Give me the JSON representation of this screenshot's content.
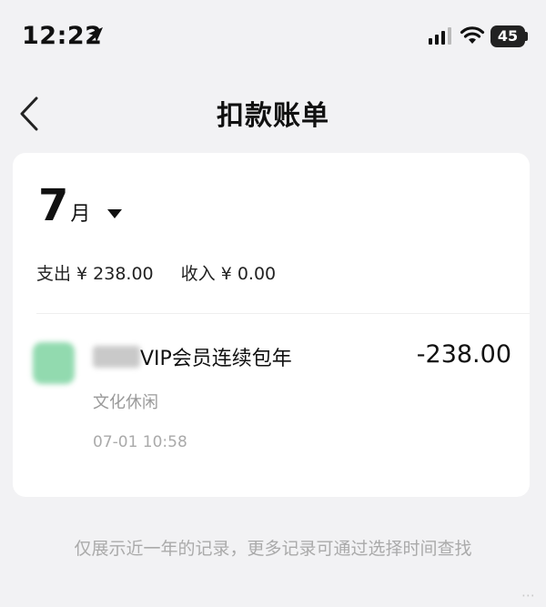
{
  "status_bar": {
    "time": "12:22",
    "battery": "45"
  },
  "nav": {
    "title": "扣款账单"
  },
  "month": {
    "number": "7",
    "unit": "月"
  },
  "summary": {
    "expense": "支出 ¥ 238.00",
    "income": "收入 ¥ 0.00"
  },
  "item": {
    "name": "VIP会员连续包年",
    "amount": "-238.00",
    "category": "文化休闲",
    "time": "07-01 10:58"
  },
  "footer_note": "仅展示近一年的记录，更多记录可通过选择时间查找",
  "colors": {
    "background": "#f2f2f4",
    "card": "#ffffff",
    "secondary_text": "#999999"
  },
  "icons": [
    "location-arrow-icon",
    "cellular-signal-icon",
    "wifi-icon",
    "battery-icon",
    "back-chevron-icon",
    "dropdown-caret-icon"
  ]
}
